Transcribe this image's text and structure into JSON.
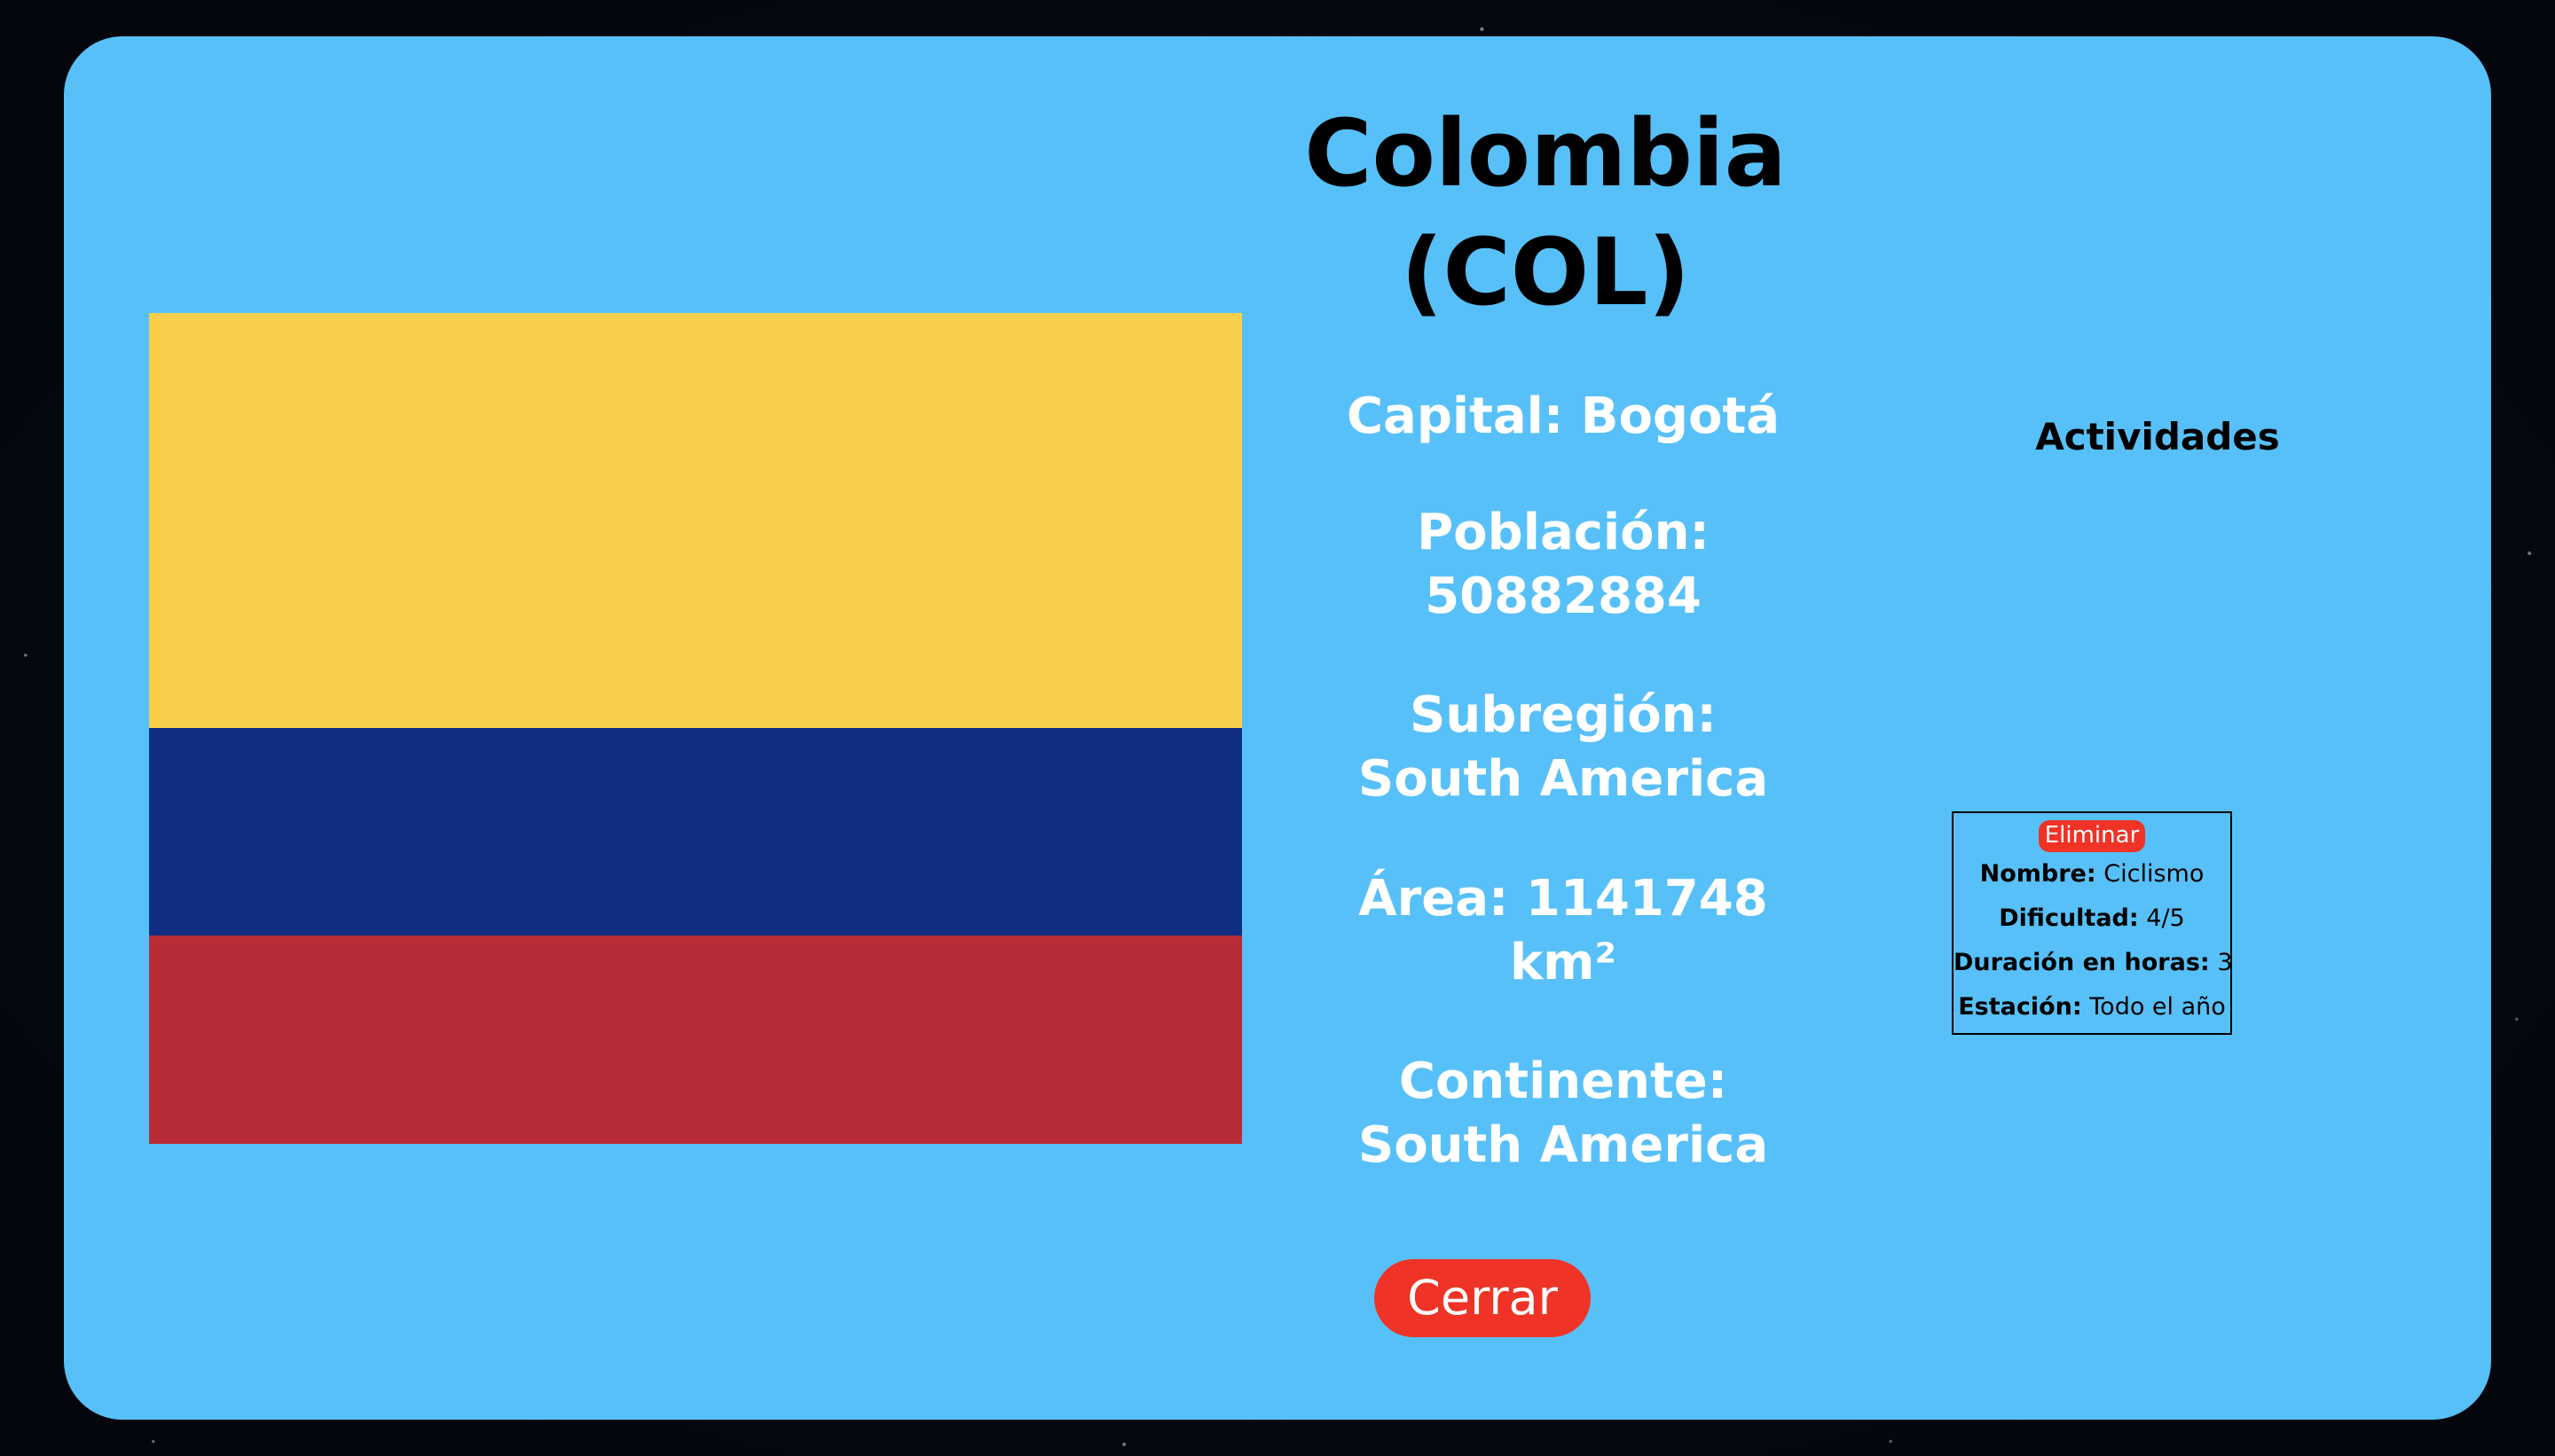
{
  "country": {
    "name": "Colombia",
    "code": "(COL)",
    "flag_colors": [
      "#f7cf4a",
      "#0f2e82",
      "#b72c37"
    ]
  },
  "details": {
    "capital_label": "Capital:",
    "capital_value": "Bogotá",
    "population_label": "Población:",
    "population_value": "50882884",
    "subregion_label": "Subregión:",
    "subregion_value": "South America",
    "area_label": "Área:",
    "area_value": "1141748",
    "area_unit": "km²",
    "continent_label": "Continente:",
    "continent_value": "South America"
  },
  "activities": {
    "title": "Actividades",
    "items": [
      {
        "delete_label": "Eliminar",
        "name_label": "Nombre:",
        "name_value": "Ciclismo",
        "difficulty_label": "Dificultad:",
        "difficulty_value": "4/5",
        "duration_label": "Duración en horas:",
        "duration_value": "3",
        "season_label": "Estación:",
        "season_value": "Todo el año"
      }
    ]
  },
  "actions": {
    "close_label": "Cerrar"
  },
  "colors": {
    "modal_background": "#58c0f8",
    "accent_red": "#ef3326"
  }
}
